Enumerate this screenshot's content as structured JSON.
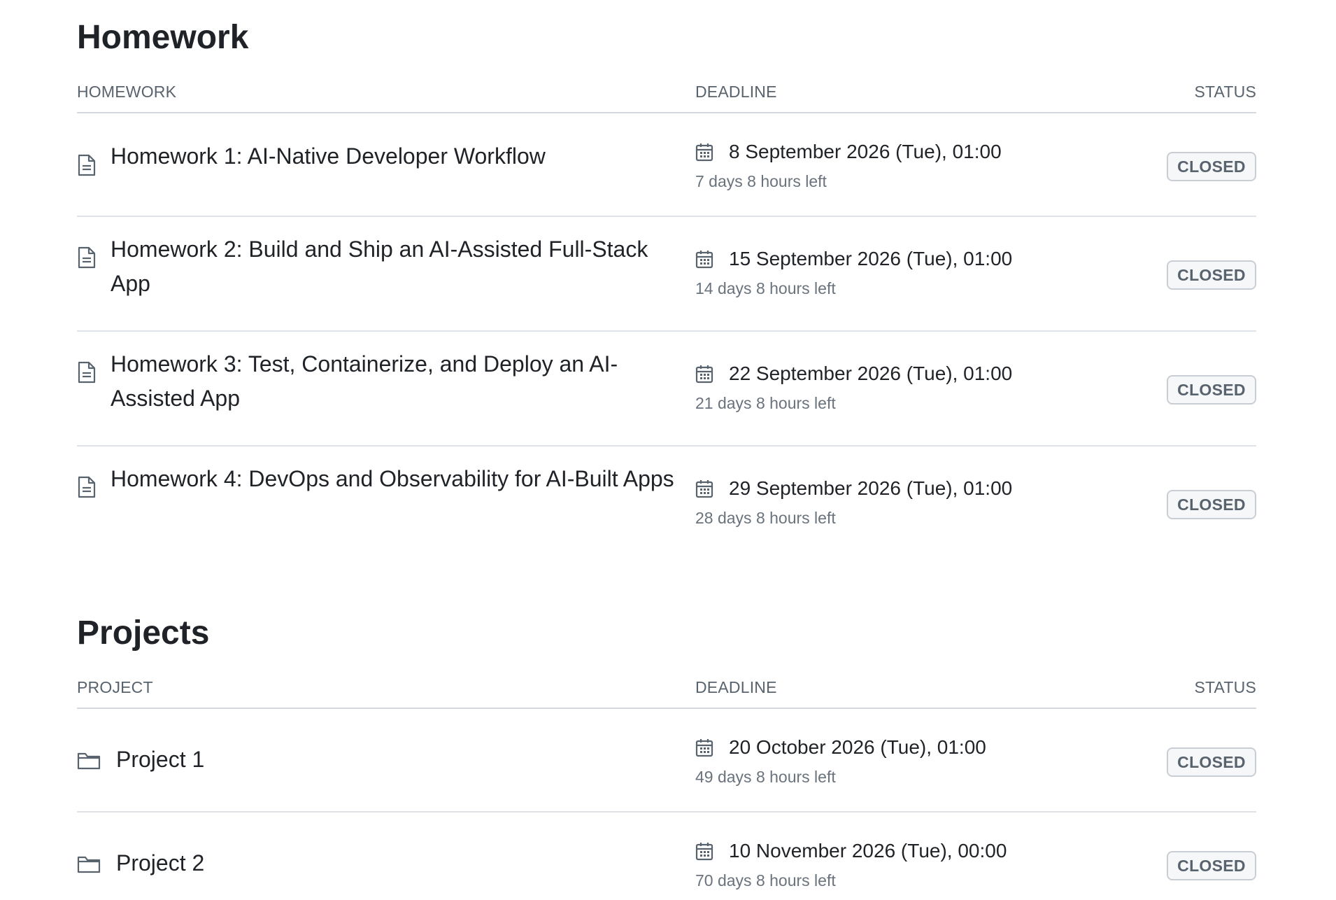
{
  "homework": {
    "title": "Homework",
    "columns": {
      "name": "HOMEWORK",
      "deadline": "DEADLINE",
      "status": "STATUS"
    },
    "items": [
      {
        "name": "Homework 1: AI-Native Developer Workflow",
        "icon": "document-icon",
        "deadline": "8 September 2026 (Tue), 01:00",
        "time_left": "7 days 8 hours left",
        "status": "CLOSED"
      },
      {
        "name": "Homework 2: Build and Ship an AI-Assisted Full-Stack App",
        "icon": "document-icon",
        "deadline": "15 September 2026 (Tue), 01:00",
        "time_left": "14 days 8 hours left",
        "status": "CLOSED"
      },
      {
        "name": "Homework 3: Test, Containerize, and Deploy an AI-Assisted App",
        "icon": "document-icon",
        "deadline": "22 September 2026 (Tue), 01:00",
        "time_left": "21 days 8 hours left",
        "status": "CLOSED"
      },
      {
        "name": "Homework 4: DevOps and Observability for AI-Built Apps",
        "icon": "document-icon",
        "deadline": "29 September 2026 (Tue), 01:00",
        "time_left": "28 days 8 hours left",
        "status": "CLOSED"
      }
    ]
  },
  "projects": {
    "title": "Projects",
    "columns": {
      "name": "PROJECT",
      "deadline": "DEADLINE",
      "status": "STATUS"
    },
    "items": [
      {
        "name": "Project 1",
        "icon": "folder-icon",
        "deadline": "20 October 2026 (Tue), 01:00",
        "time_left": "49 days 8 hours left",
        "status": "CLOSED"
      },
      {
        "name": "Project 2",
        "icon": "folder-icon",
        "deadline": "10 November 2026 (Tue), 00:00",
        "time_left": "70 days 8 hours left",
        "status": "CLOSED"
      }
    ]
  },
  "colors": {
    "text": "#1f2328",
    "muted": "#6a737d",
    "divider": "#dfe3e8",
    "badge_border": "#c9ced4",
    "badge_bg": "#f6f7f9"
  }
}
